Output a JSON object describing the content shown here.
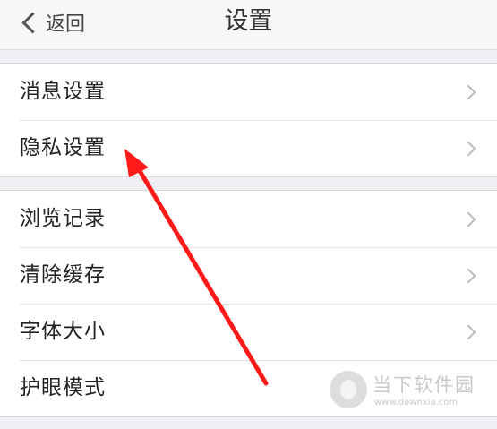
{
  "nav": {
    "back_label": "返回",
    "title": "设置"
  },
  "groups": [
    {
      "items": [
        {
          "label": "消息设置"
        },
        {
          "label": "隐私设置"
        }
      ]
    },
    {
      "items": [
        {
          "label": "浏览记录"
        },
        {
          "label": "清除缓存"
        },
        {
          "label": "字体大小"
        },
        {
          "label": "护眼模式"
        }
      ]
    }
  ],
  "annotation": {
    "arrow_color": "#ff1a1a",
    "points_to": "隐私设置"
  },
  "watermark": {
    "text": "当下软件园",
    "url": "www.downxia.com"
  }
}
